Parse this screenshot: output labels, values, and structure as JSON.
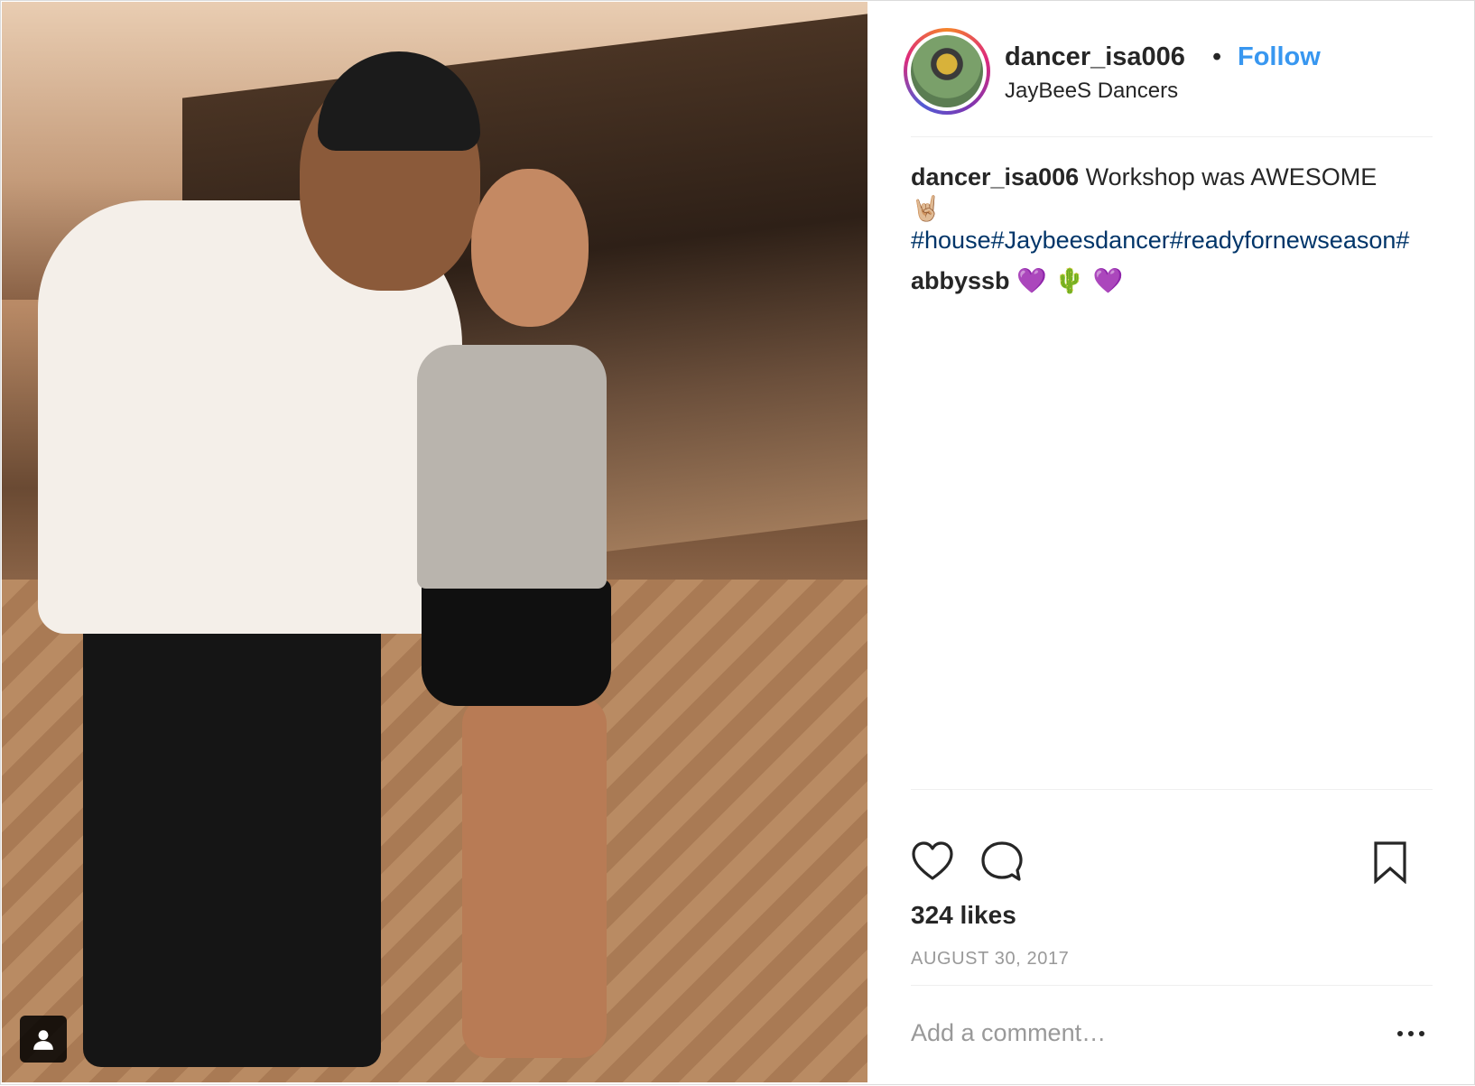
{
  "post": {
    "username": "dancer_isa006",
    "separator": "•",
    "follow_label": "Follow",
    "location": "JayBeeS Dancers"
  },
  "caption": {
    "author": "dancer_isa006",
    "text": "Workshop was AWESOME",
    "emoji": "🤘🏼",
    "hashtags": "#house#Jaybeesdancer#readyfornewseason#"
  },
  "comments": [
    {
      "author": "abbyssb",
      "text": "💜 🌵 💜"
    }
  ],
  "actions": {
    "like_icon": "heart-icon",
    "comment_icon": "speech-bubble-icon",
    "save_icon": "bookmark-icon"
  },
  "likes": "324 likes",
  "date": "AUGUST 30, 2017",
  "add_comment": {
    "placeholder": "Add a comment…"
  },
  "more_icon": "ellipsis-icon",
  "photo": {
    "tagged_people_icon": "person-icon"
  },
  "colors": {
    "link": "#3897f0",
    "hashtag": "#003569",
    "muted": "#999999",
    "text": "#262626"
  }
}
